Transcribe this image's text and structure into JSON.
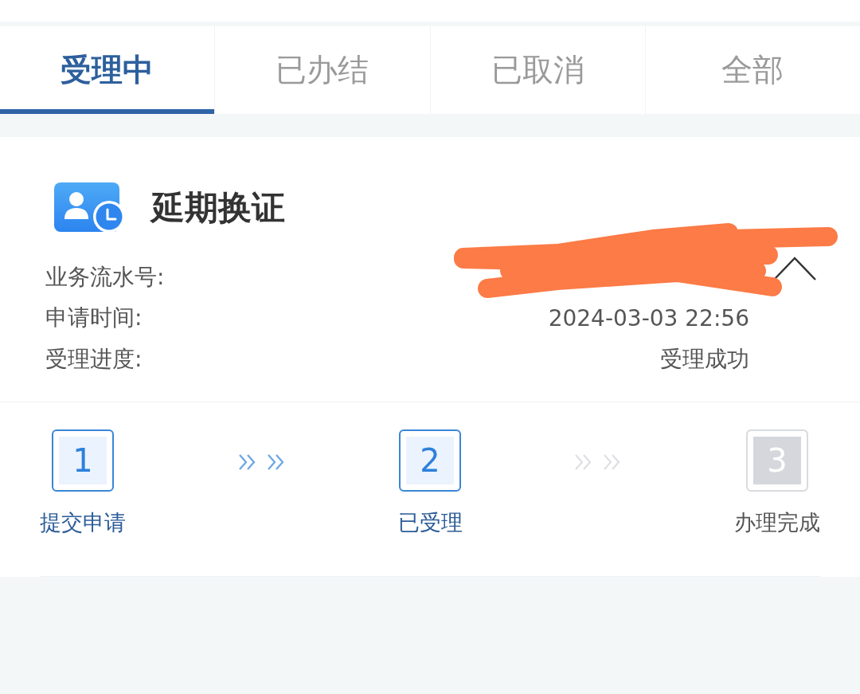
{
  "tabs": [
    {
      "label": "受理中",
      "selected": true
    },
    {
      "label": "已办结",
      "selected": false
    },
    {
      "label": "已取消",
      "selected": false
    },
    {
      "label": "全部",
      "selected": false
    }
  ],
  "card": {
    "title": "延期换证",
    "expanded": true,
    "fields": [
      {
        "label": "业务流水号:",
        "redacted": true
      },
      {
        "label": "申请时间:",
        "value": "2024-03-03 22:56"
      },
      {
        "label": "受理进度:",
        "value": "受理成功"
      }
    ],
    "steps": [
      {
        "number": "1",
        "label": "提交申请",
        "done": true
      },
      {
        "number": "2",
        "label": "已受理",
        "done": true
      },
      {
        "number": "3",
        "label": "办理完成",
        "done": false
      }
    ]
  }
}
